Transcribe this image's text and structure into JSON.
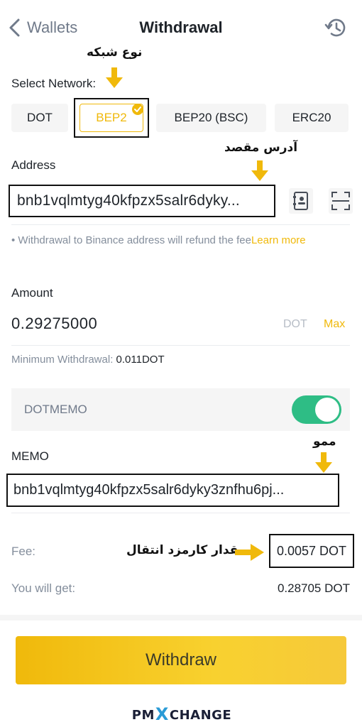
{
  "header": {
    "back_label": "Wallets",
    "title": "Withdrawal"
  },
  "annotations": {
    "network": "نوع شبکه",
    "address": "آدرس مقصد",
    "memo": "ممو",
    "fee": "مقدار کارمزد انتقال"
  },
  "network": {
    "label": "Select Network:",
    "options": [
      "DOT",
      "BEP2",
      "BEP20 (BSC)",
      "ERC20"
    ],
    "selected": "BEP2"
  },
  "address": {
    "label": "Address",
    "value": "bnb1vqlmtyg40kfpzx5salr6dyky..."
  },
  "note": {
    "text": "• Withdrawal to Binance address will refund the fee",
    "link": "Learn more"
  },
  "amount": {
    "label": "Amount",
    "value": "0.29275000",
    "unit": "DOT",
    "max_label": "Max"
  },
  "minimum": {
    "label": "Minimum Withdrawal: ",
    "value": "0.011DOT"
  },
  "memo_toggle": {
    "label": "DOTMEMO",
    "enabled": true
  },
  "memo": {
    "label": "MEMO",
    "value": "bnb1vqlmtyg40kfpzx5salr6dyky3znfhu6pj..."
  },
  "summary": {
    "fee_label": "Fee:",
    "fee_value": "0.0057 DOT",
    "get_label": "You will get:",
    "get_value": "0.28705 DOT"
  },
  "withdraw_button": "Withdraw",
  "logo": {
    "pre": "PM",
    "x": "X",
    "post": "CHANGE"
  },
  "colors": {
    "accent": "#f0b90b",
    "toggle_on": "#2ebd85",
    "muted": "#848e9c"
  }
}
